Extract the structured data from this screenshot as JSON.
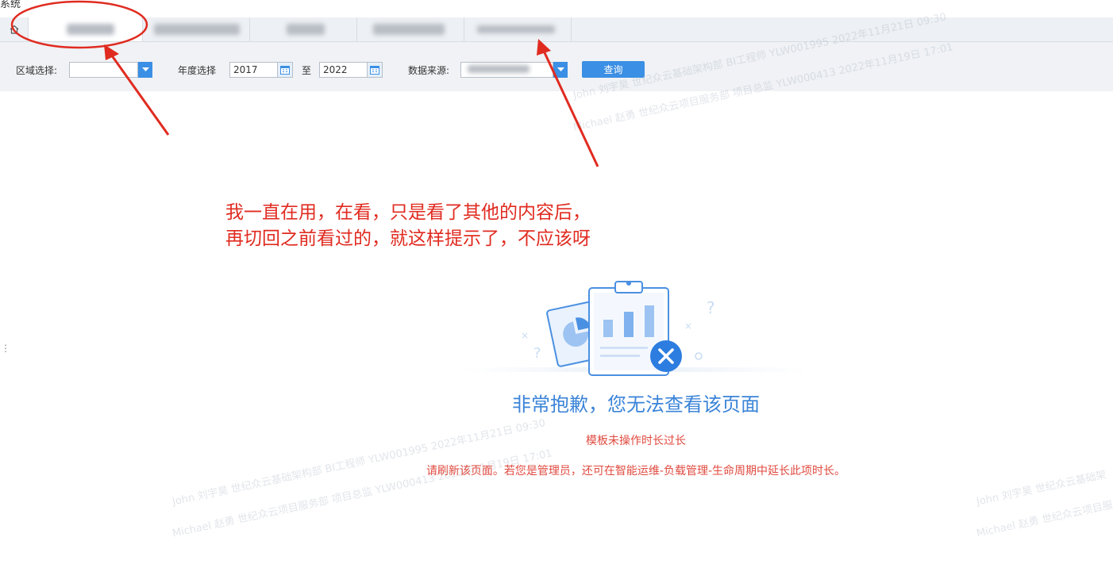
{
  "app": {
    "title": "系统"
  },
  "tabs": {
    "home_icon": "home-icon"
  },
  "filters": {
    "region_label": "区域选择:",
    "region_value": "",
    "year_label": "年度选择",
    "year_from": "2017",
    "year_sep": "至",
    "year_to": "2022",
    "source_label": "数据来源:",
    "source_value": "",
    "query_label": "查询"
  },
  "annotation": {
    "line1": "我一直在用，在看，只是看了其他的内容后，",
    "line2": "再切回之前看过的，就这样提示了，不应该呀",
    "color": "#e02b20"
  },
  "error": {
    "title": "非常抱歉，您无法查看该页面",
    "reason": "模板未操作时长过长",
    "hint": "请刷新该页面。若您是管理员，还可在智能运维-负载管理-生命周期中延长此项时长。"
  },
  "watermarks": {
    "w1": "John 刘宇昊 世纪众云基础架构部 BI工程师 YLW001995 2022年11月21日 09:30",
    "w2": "Michael 赵勇 世纪众云项目服务部 项目总监 YLW000413 2022年11月19日 17:01",
    "w3": "John 刘宇昊 世纪众云基础架构部 BI工程师 YLW001995 2022年11月21日 09:30",
    "w4": "Michael 赵勇 世纪众云项目服务部 项目总监 YLW000413 2022年11月19日 17:01",
    "w5": "John 刘宇昊 世纪众云基础架",
    "w6": "Michael 赵勇 世纪众云项目服"
  },
  "colors": {
    "accent": "#3b8fe4",
    "error_title": "#3b84d8",
    "error_text": "#e04a3f"
  }
}
